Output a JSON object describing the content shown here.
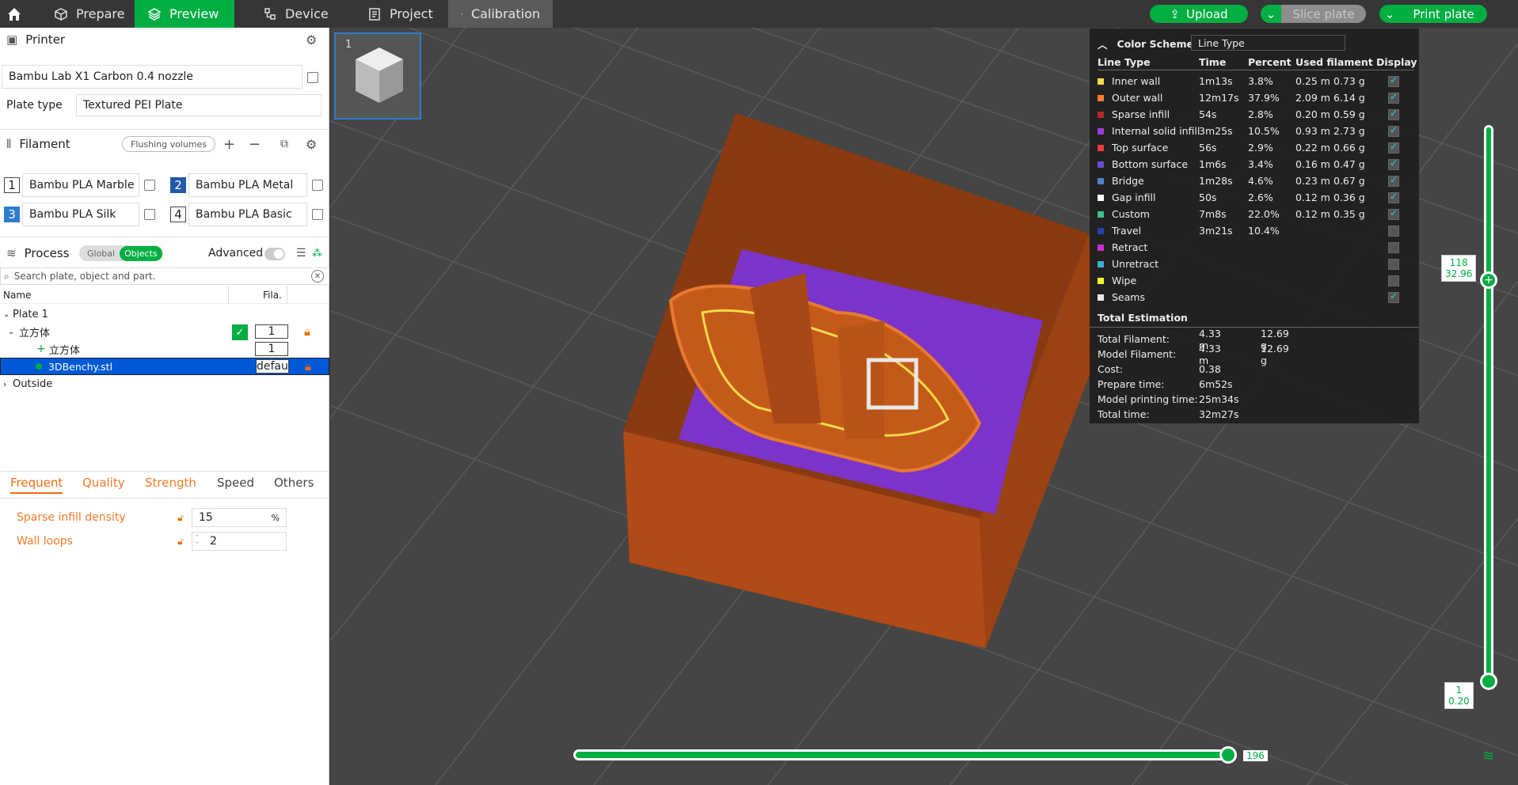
{
  "topbar": {
    "tabs": [
      {
        "label": "Prepare"
      },
      {
        "label": "Preview"
      },
      {
        "label": "Device"
      },
      {
        "label": "Project"
      },
      {
        "label": "Calibration"
      }
    ],
    "upload_label": "Upload",
    "slice_label": "Slice plate",
    "print_label": "Print plate",
    "accent": "#00ae42"
  },
  "printer": {
    "title": "Printer",
    "name": "Bambu Lab X1 Carbon 0.4 nozzle",
    "plate_type_label": "Plate type",
    "plate_type": "Textured PEI Plate"
  },
  "filament": {
    "title": "Filament",
    "flushing_label": "Flushing volumes",
    "items": [
      {
        "num": "1",
        "name": "Bambu PLA Marble"
      },
      {
        "num": "2",
        "name": "Bambu PLA Metal"
      },
      {
        "num": "3",
        "name": "Bambu PLA Silk"
      },
      {
        "num": "4",
        "name": "Bambu PLA Basic"
      }
    ]
  },
  "process": {
    "title": "Process",
    "global_label": "Global",
    "objects_label": "Objects",
    "advanced_label": "Advanced",
    "search_placeholder": "Search plate, object and part.",
    "col_name": "Name",
    "col_fila": "Fila.",
    "tree": {
      "plate": "Plate 1",
      "object": "立方体",
      "object_fila": "1",
      "part1": "立方体",
      "part1_fila": "1",
      "part2": "3DBenchy.stl",
      "part2_fila": "defaul",
      "outside": "Outside"
    },
    "tabs": [
      "Frequent",
      "Quality",
      "Strength",
      "Speed",
      "Others"
    ],
    "settings": [
      {
        "label": "Sparse infill density",
        "value": "15",
        "unit": "%"
      },
      {
        "label": "Wall loops",
        "value": "2",
        "unit": ""
      }
    ]
  },
  "plate_thumb": {
    "number": "1"
  },
  "legend": {
    "title": "Color Scheme",
    "scheme": "Line Type",
    "headers": [
      "Line Type",
      "Time",
      "Percent",
      "Used filament",
      "Display"
    ],
    "rows": [
      {
        "name": "Inner wall",
        "color": "#f5d94a",
        "time": "1m13s",
        "pct": "3.8%",
        "len": "0.25 m",
        "g": "0.73 g",
        "on": true
      },
      {
        "name": "Outer wall",
        "color": "#ff7a2a",
        "time": "12m17s",
        "pct": "37.9%",
        "len": "2.09 m",
        "g": "6.14 g",
        "on": true
      },
      {
        "name": "Sparse infill",
        "color": "#b42a2a",
        "time": "54s",
        "pct": "2.8%",
        "len": "0.20 m",
        "g": "0.59 g",
        "on": true
      },
      {
        "name": "Internal solid infill",
        "color": "#9b40d6",
        "time": "3m25s",
        "pct": "10.5%",
        "len": "0.93 m",
        "g": "2.73 g",
        "on": true
      },
      {
        "name": "Top surface",
        "color": "#f23c3c",
        "time": "56s",
        "pct": "2.9%",
        "len": "0.22 m",
        "g": "0.66 g",
        "on": true
      },
      {
        "name": "Bottom surface",
        "color": "#6a4bd6",
        "time": "1m6s",
        "pct": "3.4%",
        "len": "0.16 m",
        "g": "0.47 g",
        "on": true
      },
      {
        "name": "Bridge",
        "color": "#4f7fc9",
        "time": "1m28s",
        "pct": "4.6%",
        "len": "0.23 m",
        "g": "0.67 g",
        "on": true
      },
      {
        "name": "Gap infill",
        "color": "#ffffff",
        "time": "50s",
        "pct": "2.6%",
        "len": "0.12 m",
        "g": "0.36 g",
        "on": true
      },
      {
        "name": "Custom",
        "color": "#3fc08a",
        "time": "7m8s",
        "pct": "22.0%",
        "len": "0.12 m",
        "g": "0.35 g",
        "on": true
      },
      {
        "name": "Travel",
        "color": "#2a3fa8",
        "time": "3m21s",
        "pct": "10.4%",
        "len": "",
        "g": "",
        "on": false
      },
      {
        "name": "Retract",
        "color": "#d12ad1",
        "time": "",
        "pct": "",
        "len": "",
        "g": "",
        "on": false
      },
      {
        "name": "Unretract",
        "color": "#3ab0d6",
        "time": "",
        "pct": "",
        "len": "",
        "g": "",
        "on": false
      },
      {
        "name": "Wipe",
        "color": "#f5f52a",
        "time": "",
        "pct": "",
        "len": "",
        "g": "",
        "on": false
      },
      {
        "name": "Seams",
        "color": "#e6e6e6",
        "time": "",
        "pct": "",
        "len": "",
        "g": "",
        "on": true
      }
    ],
    "total_title": "Total Estimation",
    "totals": [
      {
        "label": "Total Filament:",
        "v1": "4.33 m",
        "v2": "12.69 g"
      },
      {
        "label": "Model Filament:",
        "v1": "4.33 m",
        "v2": "12.69 g"
      },
      {
        "label": "Cost:",
        "v1": "0.38",
        "v2": ""
      },
      {
        "label": "Prepare time:",
        "v1": "6m52s",
        "v2": ""
      },
      {
        "label": "Model printing time:",
        "v1": "25m34s",
        "v2": ""
      },
      {
        "label": "Total time:",
        "v1": "32m27s",
        "v2": ""
      }
    ]
  },
  "sliders": {
    "top_layer": "118",
    "top_height": "32.96",
    "bottom_layer": "1",
    "bottom_height": "0.20",
    "move_value": "196"
  }
}
